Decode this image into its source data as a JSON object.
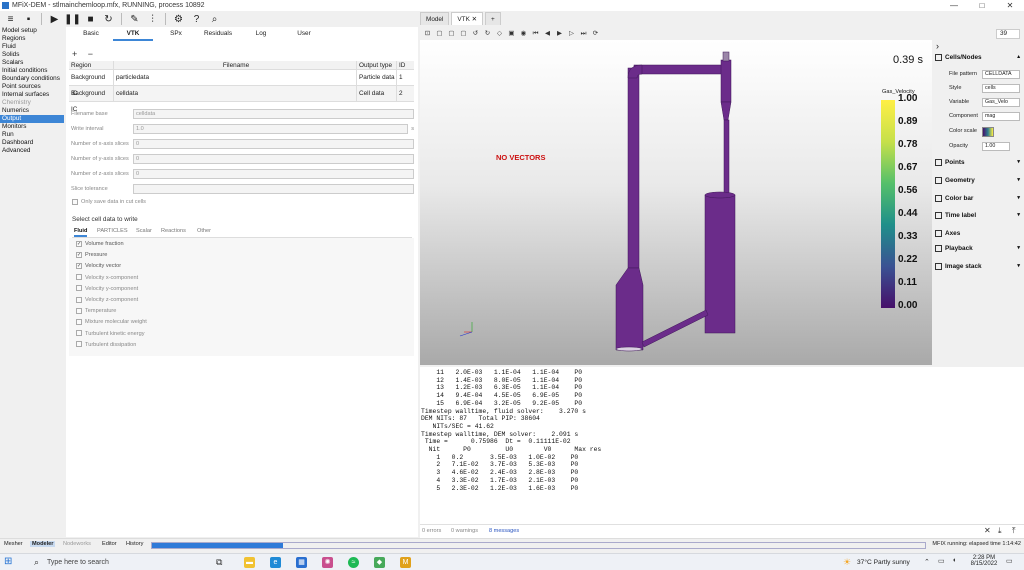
{
  "window": {
    "title": "MFiX-DEM - stlmainchemloop.mfx, RUNNING, process 10892",
    "controls": [
      "—",
      "□",
      "✕"
    ]
  },
  "toolbar": {
    "icons": [
      "menu-icon",
      "save-icon",
      "play-icon",
      "pause-icon",
      "stop-icon",
      "reset-icon",
      "build-icon",
      "parameters-icon",
      "settings-icon",
      "help-icon",
      "search-icon"
    ]
  },
  "nav": [
    {
      "label": "Model setup",
      "state": "normal"
    },
    {
      "label": "Regions",
      "state": "normal"
    },
    {
      "label": "Fluid",
      "state": "normal"
    },
    {
      "label": "Solids",
      "state": "normal"
    },
    {
      "label": "Scalars",
      "state": "normal"
    },
    {
      "label": "Initial conditions",
      "state": "normal"
    },
    {
      "label": "Boundary conditions",
      "state": "normal"
    },
    {
      "label": "Point sources",
      "state": "normal"
    },
    {
      "label": "Internal surfaces",
      "state": "normal"
    },
    {
      "label": "Chemistry",
      "state": "dis"
    },
    {
      "label": "Numerics",
      "state": "normal"
    },
    {
      "label": "Output",
      "state": "sel"
    },
    {
      "label": "Monitors",
      "state": "normal"
    },
    {
      "label": "Run",
      "state": "normal"
    },
    {
      "label": "Dashboard",
      "state": "normal"
    },
    {
      "label": "Advanced",
      "state": "normal"
    }
  ],
  "output": {
    "tabs": [
      "Basic",
      "VTK",
      "SPx",
      "Residuals",
      "Log",
      "User"
    ],
    "selected_tab": "VTK",
    "add_remove": "+ −",
    "table": {
      "headers": [
        "Region",
        "Filename",
        "Output type",
        "ID"
      ],
      "rows": [
        [
          "Background IC",
          "particledata",
          "Particle data",
          "1"
        ],
        [
          "Background IC",
          "celldata",
          "Cell data",
          "2"
        ]
      ]
    },
    "fields": [
      {
        "label": "Filename base",
        "value": "celldata",
        "unit": ""
      },
      {
        "label": "Write interval",
        "value": "1.0",
        "unit": "s"
      },
      {
        "label": "Number of x-axis slices",
        "value": "0",
        "unit": ""
      },
      {
        "label": "Number of y-axis slices",
        "value": "0",
        "unit": ""
      },
      {
        "label": "Number of z-axis slices",
        "value": "0",
        "unit": ""
      },
      {
        "label": "Slice tolerance",
        "value": "",
        "unit": ""
      }
    ],
    "only_cut_cells": "Only save data in cut cells",
    "select_title": "Select cell data to write",
    "data_tabs": [
      "Fluid",
      "PARTICLES",
      "Scalar",
      "Reactions",
      "Other"
    ],
    "checks": [
      {
        "label": "Volume fraction",
        "checked": true
      },
      {
        "label": "Pressure",
        "checked": true
      },
      {
        "label": "Velocity vector",
        "checked": true
      },
      {
        "label": "Velocity x-component",
        "checked": false
      },
      {
        "label": "Velocity y-component",
        "checked": false
      },
      {
        "label": "Velocity z-component",
        "checked": false
      },
      {
        "label": "Temperature",
        "checked": false
      },
      {
        "label": "Mixture molecular weight",
        "checked": false
      },
      {
        "label": "Turbulent kinetic energy",
        "checked": false
      },
      {
        "label": "Turbulent dissipation",
        "checked": false
      }
    ]
  },
  "right_tabs": {
    "model": "Model",
    "vtk": "VTK",
    "vtk_close": "✕",
    "add": "+"
  },
  "vtk_toolbar": {
    "icons": [
      "reset-view-icon",
      "xy-plane-icon",
      "xz-plane-icon",
      "yz-plane-icon",
      "rotate-left-icon",
      "rotate-right-icon",
      "perspective-icon",
      "screenshot-icon",
      "camera-icon",
      "first-frame-icon",
      "prev-frame-icon",
      "play-icon",
      "next-frame-icon",
      "last-frame-icon",
      "repeat-icon"
    ],
    "frame": "39"
  },
  "viewport": {
    "time": "0.39 s",
    "no_vectors": "NO VECTORS",
    "colorbar_title": "Gas_Velocity",
    "colorbar_ticks": [
      "1.00",
      "0.89",
      "0.78",
      "0.67",
      "0.56",
      "0.44",
      "0.33",
      "0.22",
      "0.11",
      "0.00"
    ]
  },
  "properties": {
    "sections": [
      {
        "title": "Cells/Nodes",
        "dd": "▴"
      },
      {
        "title": "Points",
        "dd": "▾"
      },
      {
        "title": "Geometry",
        "dd": "▾"
      },
      {
        "title": "Color bar",
        "dd": "▾"
      },
      {
        "title": "Time label",
        "dd": "▾"
      },
      {
        "title": "Axes",
        "dd": ""
      },
      {
        "title": "Playback",
        "dd": "▾"
      },
      {
        "title": "Image stack",
        "dd": "▾"
      }
    ],
    "rows": [
      {
        "label": "File pattern",
        "value": "CELLDATA"
      },
      {
        "label": "Style",
        "value": "cells"
      },
      {
        "label": "Variable",
        "value": "Gas_Velo"
      },
      {
        "label": "Component",
        "value": "mag"
      },
      {
        "label": "Color scale",
        "value": ""
      },
      {
        "label": "Opacity",
        "value": "1.00"
      }
    ],
    "collapse": "›"
  },
  "console": {
    "text": "    11   2.0E-03   1.1E-04   1.1E-04    P0\n    12   1.4E-03   8.0E-05   1.1E-04    P0\n    13   1.2E-03   6.3E-05   1.1E-04    P0\n    14   9.4E-04   4.5E-05   6.9E-05    P0\n    15   6.9E-04   3.2E-05   9.2E-05    P0\nTimestep walltime, fluid solver:    3.270 s\nDEM NITs: 87   Total PIP: 38604\n   NITs/SEC = 41.62\nTimestep walltime, DEM solver:    2.091 s\n Time =      0.75986  Dt =  0.11111E-02\n  Nit      P0         U0        V0      Max res\n    1   0.2       3.5E-03   1.0E-02    P0\n    2   7.1E-02   3.7E-03   5.3E-03    P0\n    3   4.6E-02   2.4E-03   2.8E-03    P0\n    4   3.3E-02   1.7E-03   2.1E-03    P0\n    5   2.3E-02   1.2E-03   1.6E-03    P0",
    "errors": "0 errors",
    "warnings": "0 warnings",
    "messages": "8 messages",
    "buttons": [
      "✕",
      "⤓",
      "⤒"
    ]
  },
  "bottombar": {
    "tabs": [
      "Mesher",
      "Modeler",
      "Nodeworks",
      "Editor",
      "History"
    ],
    "selected": "Modeler",
    "disabled": "Nodeworks",
    "progress": 0.17,
    "status": "MFIX running: elapsed time 1:14:42"
  },
  "taskbar": {
    "search": "Type here to search",
    "weather": "37°C  Partly sunny",
    "time": "2:28 PM",
    "date": "8/15/2022",
    "colors": {
      "accent": "#2f7ad8",
      "file": "#f1c232",
      "edge": "#1f8ad6",
      "store": "#2a6fd0",
      "mfix": "#e0a11b"
    }
  }
}
